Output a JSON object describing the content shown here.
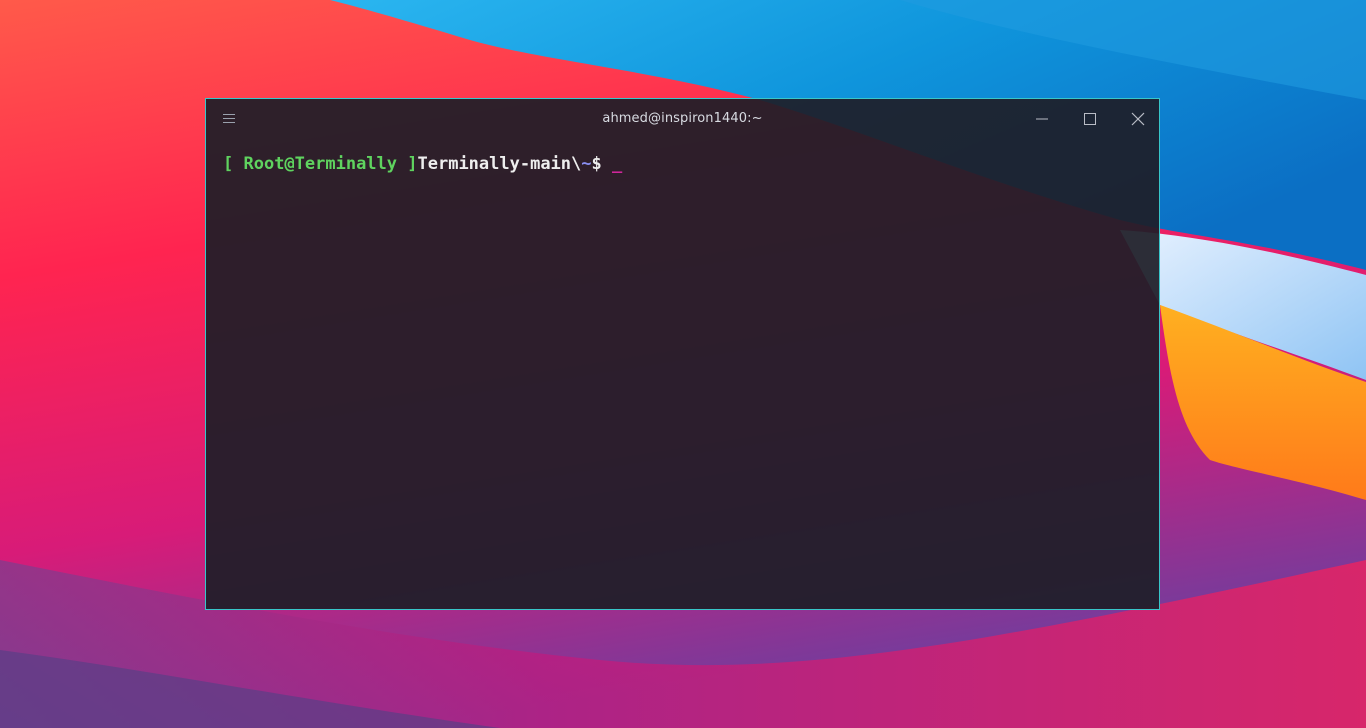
{
  "window": {
    "title": "ahmed@inspiron1440:~",
    "border_color": "#38c6c9",
    "background": "#1e1e28"
  },
  "titlebar": {
    "menu_icon": "hamburger-menu-icon",
    "minimize_icon": "minimize-icon",
    "maximize_icon": "maximize-icon",
    "close_icon": "close-icon"
  },
  "prompt": {
    "open_bracket": "[ ",
    "user_host": "Root@Terminally",
    "close_bracket": " ]",
    "directory": "Terminally-main\\",
    "tilde": "~",
    "dollar": "$ ",
    "cursor": "_"
  },
  "colors": {
    "prompt_green": "#5fd35f",
    "prompt_white": "#eeeeee",
    "tilde_blue": "#8a8ef0",
    "cursor_magenta": "#d0269b"
  }
}
